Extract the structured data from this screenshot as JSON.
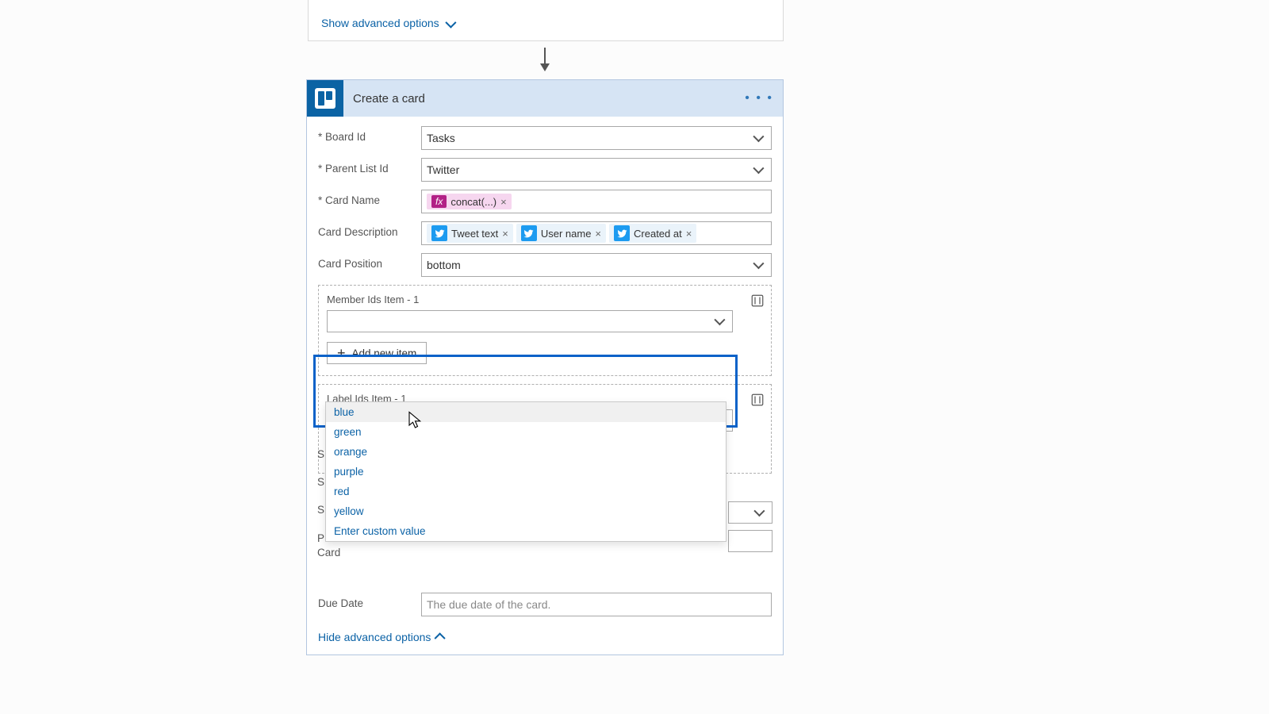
{
  "top": {
    "show_advanced": "Show advanced options"
  },
  "action": {
    "title": "Create a card",
    "fields": {
      "board_id": {
        "label": "Board Id",
        "value": "Tasks",
        "required": true
      },
      "parent_list_id": {
        "label": "Parent List Id",
        "value": "Twitter",
        "required": true
      },
      "card_name": {
        "label": "Card Name",
        "required": true,
        "pill_fx": "fx",
        "pill_text": "concat(...)"
      },
      "card_description": {
        "label": "Card Description",
        "tokens": [
          "Tweet text",
          "User name",
          "Created at"
        ]
      },
      "card_position": {
        "label": "Card Position",
        "value": "bottom"
      },
      "member_ids": {
        "label": "Member Ids Item - 1",
        "add_button": "Add new item"
      },
      "label_ids": {
        "label": "Label Ids Item - 1",
        "options": [
          "blue",
          "green",
          "orange",
          "purple",
          "red",
          "yellow",
          "Enter custom value"
        ]
      },
      "hidden_s1": "S",
      "hidden_s2": "S",
      "hidden_s3": "S",
      "previous_card": "P\nCard",
      "due_date": {
        "label": "Due Date",
        "placeholder": "The due date of the card."
      }
    },
    "hide_advanced": "Hide advanced options"
  }
}
